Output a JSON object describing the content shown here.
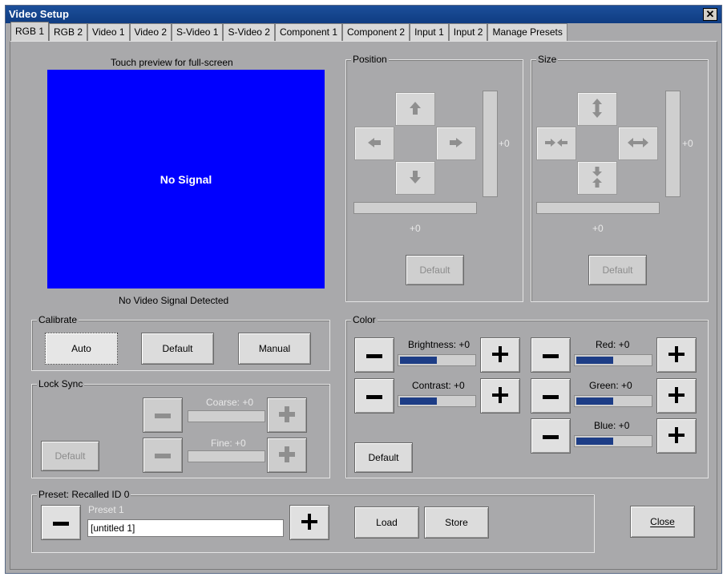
{
  "window": {
    "title": "Video Setup",
    "close_glyph": "✕"
  },
  "tabs": [
    "RGB 1",
    "RGB 2",
    "Video 1",
    "Video 2",
    "S-Video 1",
    "S-Video 2",
    "Component 1",
    "Component 2",
    "Input 1",
    "Input 2",
    "Manage Presets"
  ],
  "active_tab": "RGB 1",
  "preview": {
    "hint": "Touch preview for full-screen",
    "overlay": "No Signal",
    "status": "No Video Signal Detected",
    "bg_color": "#0000ff"
  },
  "position": {
    "label": "Position",
    "h_value": "+0",
    "v_value": "+0",
    "default_label": "Default"
  },
  "size": {
    "label": "Size",
    "h_value": "+0",
    "v_value": "+0",
    "default_label": "Default"
  },
  "calibrate": {
    "label": "Calibrate",
    "auto": "Auto",
    "default": "Default",
    "manual": "Manual"
  },
  "lock_sync": {
    "label": "Lock Sync",
    "coarse": "Coarse: +0",
    "fine": "Fine: +0",
    "default": "Default"
  },
  "color": {
    "label": "Color",
    "default": "Default",
    "brightness": {
      "label": "Brightness: +0",
      "level": 0.5
    },
    "contrast": {
      "label": "Contrast: +0",
      "level": 0.5
    },
    "red": {
      "label": "Red: +0",
      "level": 0.5
    },
    "green": {
      "label": "Green: +0",
      "level": 0.5
    },
    "blue": {
      "label": "Blue: +0",
      "level": 0.5
    },
    "bar_color": "#1d3d86"
  },
  "preset": {
    "label": "Preset: Recalled ID 0",
    "name_caption": "Preset 1",
    "name_value": "[untitled 1]",
    "load": "Load",
    "store": "Store"
  },
  "close_label": "Close"
}
